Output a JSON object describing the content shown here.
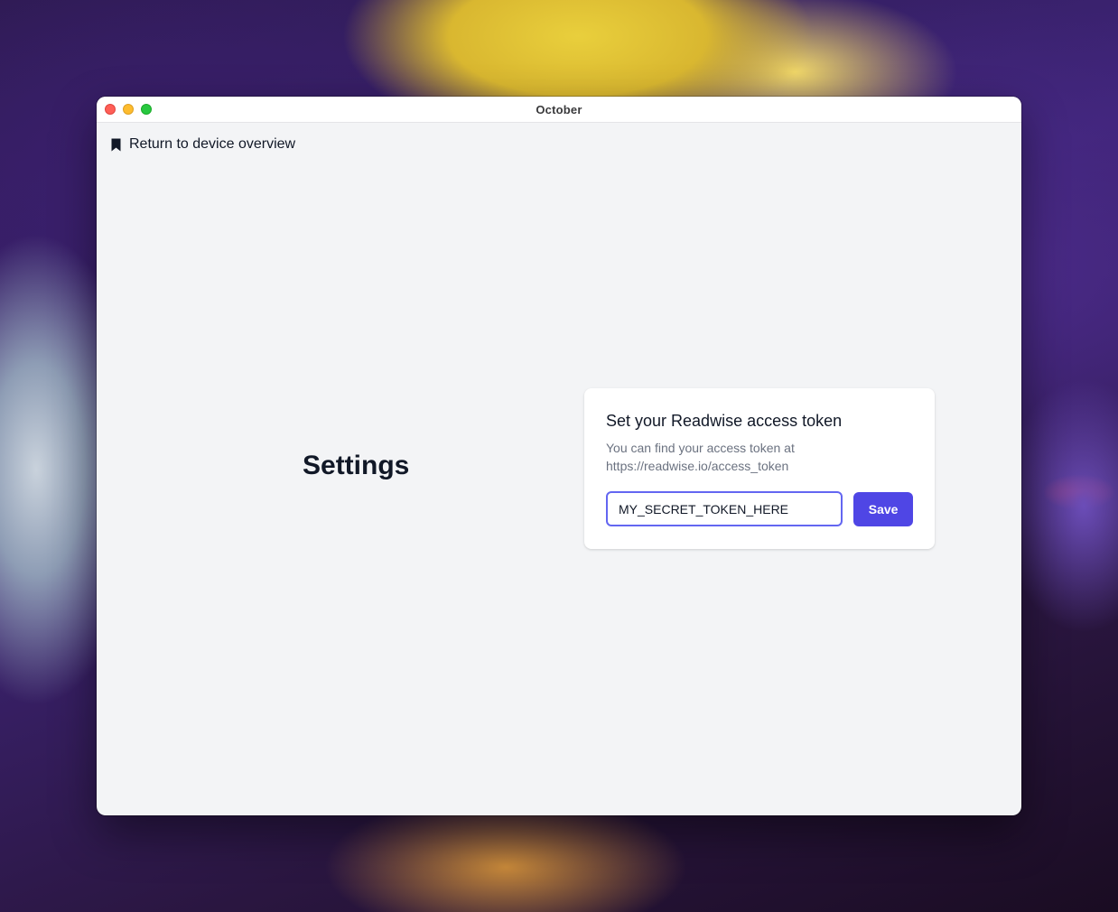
{
  "window": {
    "title": "October"
  },
  "nav": {
    "back_label": "Return to device overview",
    "back_icon": "bookmark-icon"
  },
  "page": {
    "heading": "Settings"
  },
  "readwise_card": {
    "title": "Set your Readwise access token",
    "description": "You can find your access token at https://readwise.io/access_token",
    "token_value": "MY_SECRET_TOKEN_HERE",
    "save_label": "Save"
  },
  "colors": {
    "accent": "#4f46e5",
    "focus_ring": "#6366f1",
    "window_bg": "#f3f4f6"
  }
}
